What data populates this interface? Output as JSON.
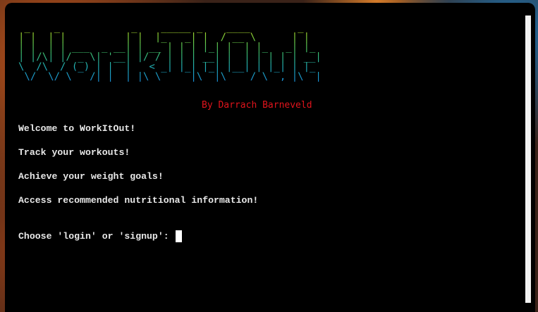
{
  "terminal": {
    "banner_ascii": " _    _            _    _____ _    ____        _   \n| |  | |          | |  |_   _| |  / __ \\      | |  \n| |  | | ___  _ __| | __ | | | |_| |  | |_   _| |_ \n| |/\\| |/ _ \\| '__| |/ / | | | __| |  | | | | | __|\n\\  /\\  / (_) | |  |   < _| |_| |_| |__| | |_| | |_ \n \\/  \\/ \\___/|_|  |_|\\_\\_____|\\__|\\____/ \\__,_|\\__|",
    "author": "By Darrach Barneveld",
    "messages": [
      "Welcome to WorkItOut!",
      "Track your workouts!",
      "Achieve your weight goals!",
      "Access recommended nutritional information!"
    ],
    "prompt": "Choose 'login' or 'signup':"
  },
  "colors": {
    "background": "#000000",
    "text": "#e8e8e8",
    "author": "#e0141c",
    "banner_gradient_top": "#e8d81a",
    "banner_gradient_bottom": "#1a8fd6"
  }
}
